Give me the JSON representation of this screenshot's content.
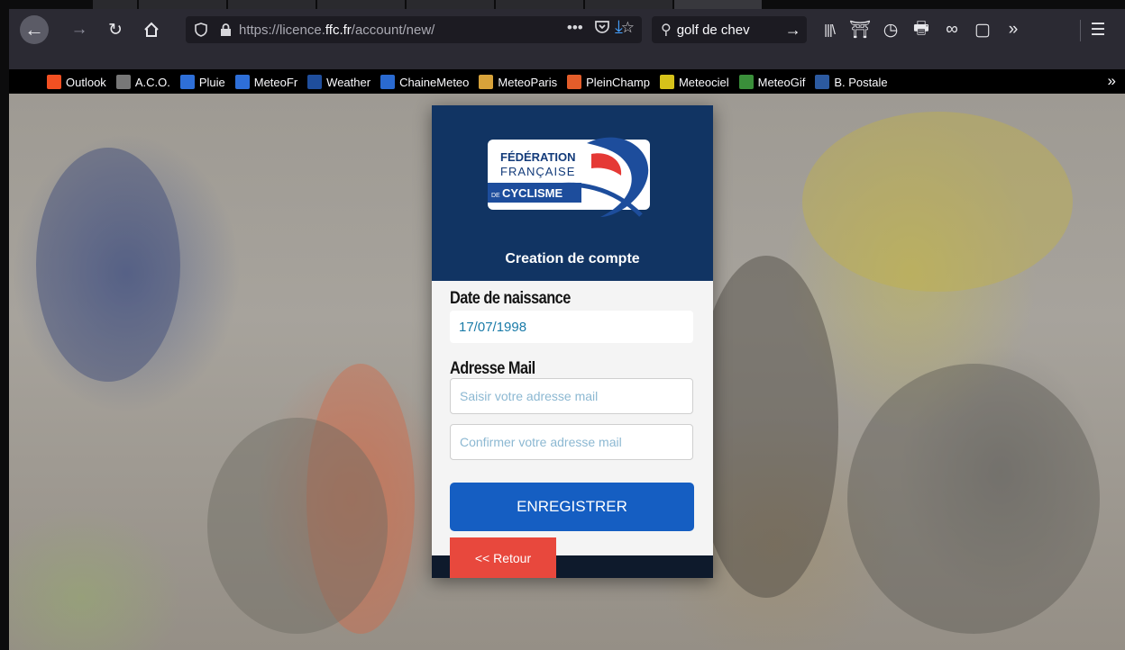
{
  "browser": {
    "url_prefix": "https://licence.",
    "url_domain": "ffc.fr",
    "url_path": "/account/new/",
    "search_value": "golf de chev",
    "bookmarks": [
      {
        "label": "Outlook",
        "icon": "outlook-icon",
        "color": "#f25022"
      },
      {
        "label": "A.C.O.",
        "icon": "aco-icon",
        "color": "#777777"
      },
      {
        "label": "Pluie",
        "icon": "meteo-icon",
        "color": "#2e6fd8"
      },
      {
        "label": "MeteoFr",
        "icon": "meteo-icon",
        "color": "#2e6fd8"
      },
      {
        "label": "Weather",
        "icon": "weather-channel-icon",
        "color": "#1f4e9c"
      },
      {
        "label": "ChaineMeteo",
        "icon": "chainemeteo-icon",
        "color": "#2a6ad0"
      },
      {
        "label": "MeteoParis",
        "icon": "meteoparis-icon",
        "color": "#d7a23a"
      },
      {
        "label": "PleinChamp",
        "icon": "pleinchamp-icon",
        "color": "#e35d2a"
      },
      {
        "label": "Meteociel",
        "icon": "meteociel-icon",
        "color": "#d6c21a"
      },
      {
        "label": "MeteoGif",
        "icon": "meteogif-icon",
        "color": "#3a8f3a"
      },
      {
        "label": "B. Postale",
        "icon": "banque-postale-icon",
        "color": "#2c5aa0"
      }
    ]
  },
  "form": {
    "logo": {
      "line1": "FÉDÉRATION",
      "line2": "FRANÇAISE",
      "line3_prefix": "DE",
      "line3": "CYCLISME"
    },
    "title": "Creation de compte",
    "dob_label": "Date de naissance",
    "dob_value": "17/07/1998",
    "email_label": "Adresse Mail",
    "email_placeholder": "Saisir votre adresse mail",
    "email_confirm_placeholder": "Confirmer votre adresse mail",
    "submit_label": "ENREGISTRER",
    "back_label": "<< Retour"
  },
  "colors": {
    "header_bg": "#113463",
    "submit_bg": "#155ec2",
    "back_bg": "#e8483d"
  }
}
